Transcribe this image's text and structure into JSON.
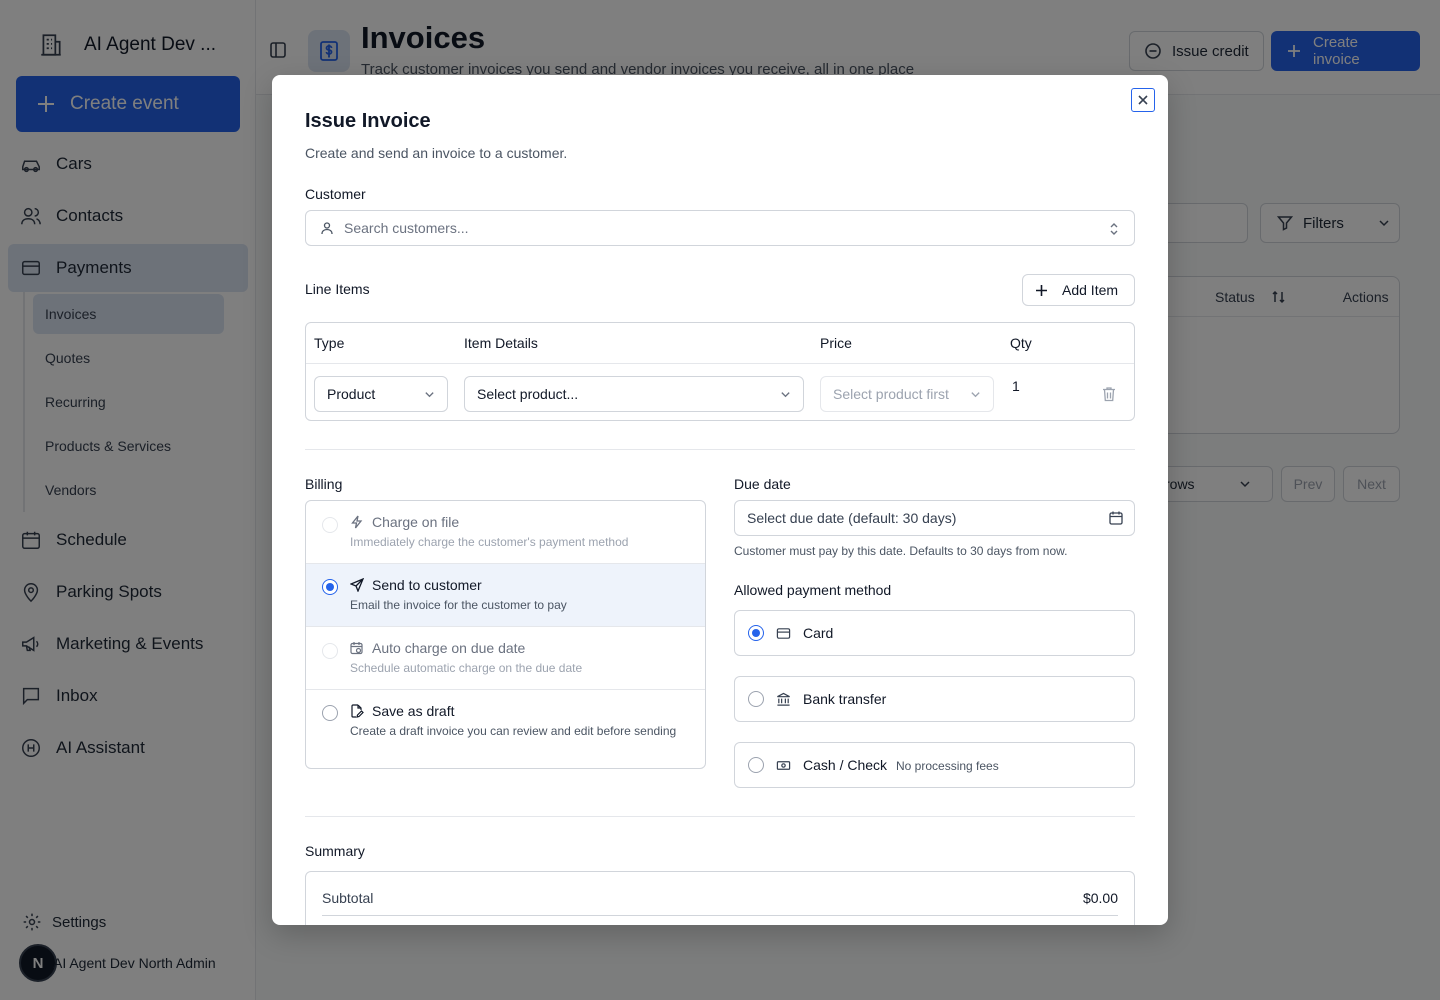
{
  "app": {
    "org_name": "AI Agent Dev ...",
    "create_event_label": "Create event",
    "nav": [
      {
        "label": "Cars",
        "icon": "car-icon"
      },
      {
        "label": "Contacts",
        "icon": "users-icon"
      },
      {
        "label": "Payments",
        "icon": "credit-card-icon",
        "active": true
      },
      {
        "label": "Schedule",
        "icon": "calendar-icon"
      },
      {
        "label": "Parking Spots",
        "icon": "map-pin-icon"
      },
      {
        "label": "Marketing & Events",
        "icon": "megaphone-icon"
      },
      {
        "label": "Inbox",
        "icon": "message-square-icon"
      },
      {
        "label": "AI Assistant",
        "icon": "bot-icon"
      }
    ],
    "payments_sub": [
      {
        "label": "Invoices",
        "active": true
      },
      {
        "label": "Quotes"
      },
      {
        "label": "Recurring"
      },
      {
        "label": "Products & Services"
      },
      {
        "label": "Vendors"
      }
    ],
    "settings_label": "Settings",
    "user_initial": "N",
    "user_name": "AI Agent Dev North Admin"
  },
  "page": {
    "title": "Invoices",
    "subtitle": "Track customer invoices you send and vendor invoices you receive, all in one place",
    "issue_credit_label": "Issue credit",
    "create_invoice_label": "Create invoice",
    "filters_label": "Filters",
    "table_headers": {
      "status": "Status",
      "actions": "Actions"
    },
    "rows_label": "rows",
    "prev_label": "Prev",
    "next_label": "Next"
  },
  "modal": {
    "title": "Issue Invoice",
    "description": "Create and send an invoice to a customer.",
    "customer_label": "Customer",
    "customer_placeholder": "Search customers...",
    "line_items_label": "Line Items",
    "add_item_label": "Add Item",
    "line_headers": {
      "type": "Type",
      "details": "Item Details",
      "price": "Price",
      "qty": "Qty"
    },
    "line_item": {
      "type": "Product",
      "product_placeholder": "Select product...",
      "price_placeholder": "Select product first",
      "qty": "1"
    },
    "billing_label": "Billing",
    "billing_options": [
      {
        "title": "Charge on file",
        "desc": "Immediately charge the customer's payment method",
        "state": "disabled"
      },
      {
        "title": "Send to customer",
        "desc": "Email the invoice for the customer to pay",
        "state": "selected"
      },
      {
        "title": "Auto charge on due date",
        "desc": "Schedule automatic charge on the due date",
        "state": "disabled"
      },
      {
        "title": "Save as draft",
        "desc": "Create a draft invoice you can review and edit before sending",
        "state": "unselected"
      }
    ],
    "due_date_label": "Due date",
    "due_date_placeholder": "Select due date (default: 30 days)",
    "due_date_hint": "Customer must pay by this date. Defaults to 30 days from now.",
    "payment_method_label": "Allowed payment method",
    "payment_methods": [
      {
        "label": "Card",
        "note": "",
        "selected": true
      },
      {
        "label": "Bank transfer",
        "note": "",
        "selected": false
      },
      {
        "label": "Cash / Check",
        "note": "No processing fees",
        "selected": false
      }
    ],
    "summary_label": "Summary",
    "subtotal_label": "Subtotal",
    "subtotal_value": "$0.00"
  },
  "colors": {
    "accent": "#2563eb",
    "active_nav": "#dbe4f3",
    "overlay": "rgba(0,0,0,0.5)"
  }
}
